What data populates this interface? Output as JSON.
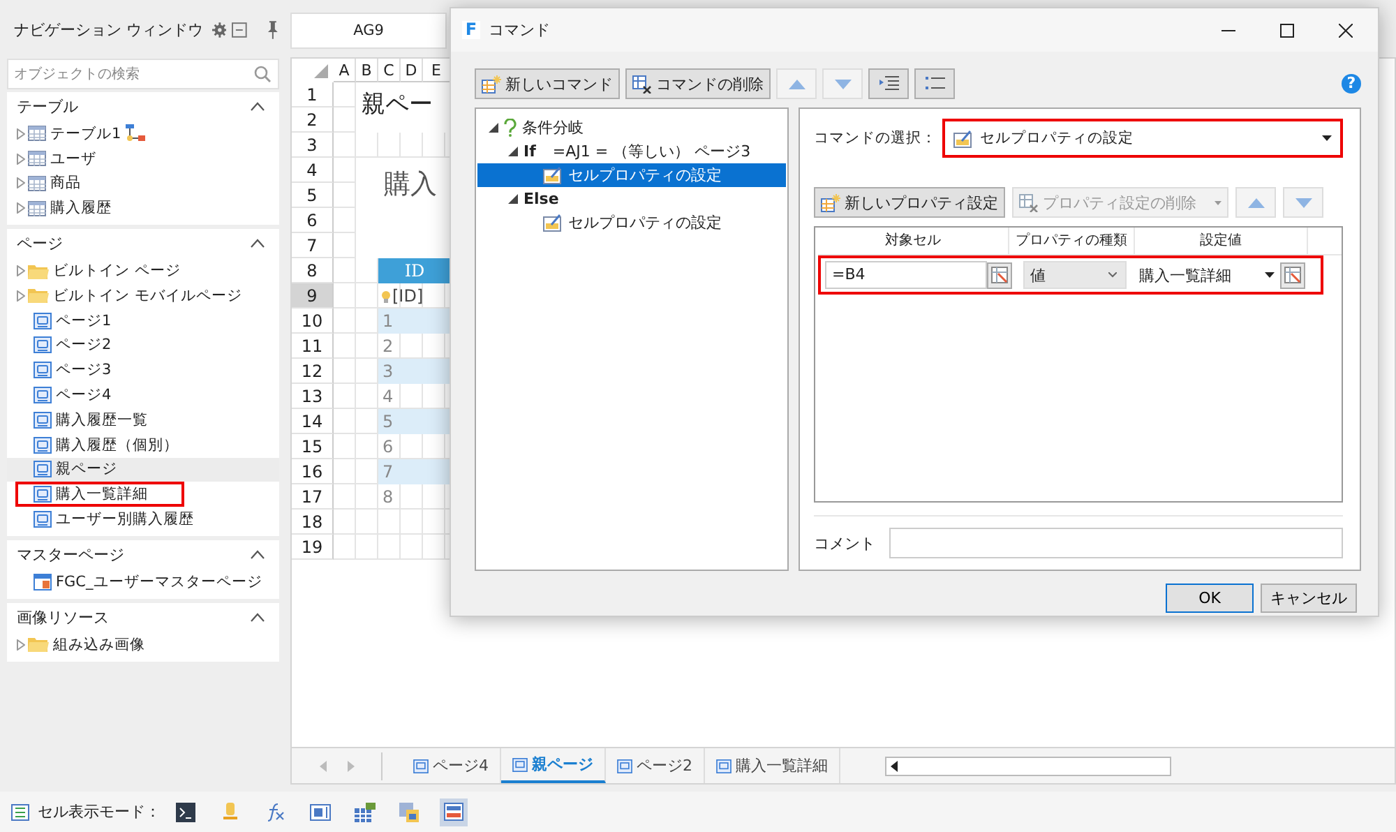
{
  "nav": {
    "title": "ナビゲーション ウィンドウ",
    "search": {
      "placeholder": "オブジェクトの検索"
    },
    "sections": [
      {
        "title": "テーブル",
        "expanded": true,
        "items": [
          {
            "label": "テーブル1",
            "kind": "table",
            "relation": true,
            "selected": false,
            "highlighted": false
          },
          {
            "label": "ユーザ",
            "kind": "table",
            "relation": false,
            "selected": false,
            "highlighted": false
          },
          {
            "label": "商品",
            "kind": "table",
            "relation": false,
            "selected": false,
            "highlighted": false
          },
          {
            "label": "購入履歴",
            "kind": "table",
            "relation": false,
            "selected": false,
            "highlighted": false
          }
        ]
      },
      {
        "title": "ページ",
        "expanded": true,
        "items": [
          {
            "label": "ビルトイン ページ",
            "kind": "folder",
            "selected": false,
            "highlighted": false
          },
          {
            "label": "ビルトイン モバイルページ",
            "kind": "folder",
            "selected": false,
            "highlighted": false
          },
          {
            "label": "ページ1",
            "kind": "page",
            "selected": false,
            "highlighted": false
          },
          {
            "label": "ページ2",
            "kind": "page",
            "selected": false,
            "highlighted": false
          },
          {
            "label": "ページ3",
            "kind": "page",
            "selected": false,
            "highlighted": false
          },
          {
            "label": "ページ4",
            "kind": "page",
            "selected": false,
            "highlighted": false
          },
          {
            "label": "購入履歴一覧",
            "kind": "page",
            "selected": false,
            "highlighted": false
          },
          {
            "label": "購入履歴（個別）",
            "kind": "page",
            "selected": false,
            "highlighted": false
          },
          {
            "label": "親ページ",
            "kind": "page",
            "selected": true,
            "highlighted": false
          },
          {
            "label": "購入一覧詳細",
            "kind": "page",
            "selected": false,
            "highlighted": true
          },
          {
            "label": "ユーザー別購入履歴",
            "kind": "page",
            "selected": false,
            "highlighted": false
          }
        ]
      },
      {
        "title": "マスターページ",
        "expanded": true,
        "items": [
          {
            "label": "FGC_ユーザーマスターページ",
            "kind": "master",
            "selected": false,
            "highlighted": false
          }
        ]
      },
      {
        "title": "画像リソース",
        "expanded": true,
        "items": [
          {
            "label": "組み込み画像",
            "kind": "folder",
            "selected": false,
            "highlighted": false
          }
        ]
      }
    ]
  },
  "sheet": {
    "name_box": "AG9",
    "columns": [
      "A",
      "B",
      "C",
      "D",
      "E"
    ],
    "rows": [
      {
        "number": "1",
        "selected": false
      },
      {
        "number": "2",
        "selected": false
      },
      {
        "number": "3",
        "selected": false
      },
      {
        "number": "4",
        "selected": false
      },
      {
        "number": "5",
        "selected": false
      },
      {
        "number": "6",
        "selected": false
      },
      {
        "number": "7",
        "selected": false
      },
      {
        "number": "8",
        "selected": false
      },
      {
        "number": "9",
        "selected": true
      },
      {
        "number": "10",
        "selected": false
      },
      {
        "number": "11",
        "selected": false
      },
      {
        "number": "12",
        "selected": false
      },
      {
        "number": "13",
        "selected": false
      },
      {
        "number": "14",
        "selected": false
      },
      {
        "number": "15",
        "selected": false
      },
      {
        "number": "16",
        "selected": false
      },
      {
        "number": "17",
        "selected": false
      },
      {
        "number": "18",
        "selected": false
      },
      {
        "number": "19",
        "selected": false
      }
    ],
    "title": "親ペー",
    "subtitle": "購入",
    "table": {
      "header": "ID",
      "binding": "[ID]",
      "values": [
        "1",
        "2",
        "3",
        "4",
        "5",
        "6",
        "7",
        "8"
      ]
    },
    "tabs": [
      {
        "label": "ページ4",
        "selected": false
      },
      {
        "label": "親ページ",
        "selected": true
      },
      {
        "label": "ページ2",
        "selected": false
      },
      {
        "label": "購入一覧詳細",
        "selected": false
      }
    ]
  },
  "dialog": {
    "logo": "F",
    "title": "コマンド",
    "help": "?",
    "toolbar": [
      {
        "label": "新しいコマンド",
        "kind": "new"
      },
      {
        "label": "コマンドの削除",
        "kind": "delete"
      },
      {
        "kind": "up"
      },
      {
        "kind": "down"
      },
      {
        "kind": "indent"
      },
      {
        "kind": "list"
      }
    ],
    "tree": [
      {
        "label": "条件分岐",
        "kind": "branch",
        "expanded": true,
        "selected": false,
        "children": [
          {
            "label": "If",
            "condition": "=AJ1 = （等しい） ページ3",
            "kind": "keyword",
            "expanded": true,
            "selected": false,
            "children": [
              {
                "label": "セルプロパティの設定",
                "kind": "command",
                "selected": true
              }
            ]
          },
          {
            "label": "Else",
            "kind": "keyword",
            "expanded": true,
            "selected": false,
            "children": [
              {
                "label": "セルプロパティの設定",
                "kind": "command",
                "selected": false
              }
            ]
          }
        ]
      }
    ],
    "command_select": {
      "label": "コマンドの選択：",
      "value": "セルプロパティの設定",
      "highlighted": true
    },
    "property_toolbar": [
      {
        "label": "新しいプロパティ設定",
        "kind": "new",
        "disabled": false
      },
      {
        "label": "プロパティ設定の削除",
        "kind": "delete",
        "disabled": true
      },
      {
        "kind": "up"
      },
      {
        "kind": "down"
      }
    ],
    "properties": {
      "columns": [
        "対象セル",
        "プロパティの種類",
        "設定値"
      ],
      "rows": [
        {
          "target": "=B4",
          "type": "値",
          "value": "購入一覧詳細",
          "highlighted": true
        }
      ]
    },
    "comment": {
      "label": "コメント"
    },
    "buttons": [
      {
        "label": "OK",
        "kind": "default"
      },
      {
        "label": "キャンセル",
        "kind": "normal"
      }
    ]
  },
  "status_bar": {
    "label": "セル表示モード：",
    "modes": [
      {
        "kind": "console",
        "selected": false
      },
      {
        "kind": "bulb",
        "selected": false
      },
      {
        "kind": "formula",
        "selected": false
      },
      {
        "kind": "textbox",
        "selected": false
      },
      {
        "kind": "table",
        "selected": false
      },
      {
        "kind": "image",
        "selected": false
      },
      {
        "kind": "list",
        "selected": true
      }
    ]
  }
}
